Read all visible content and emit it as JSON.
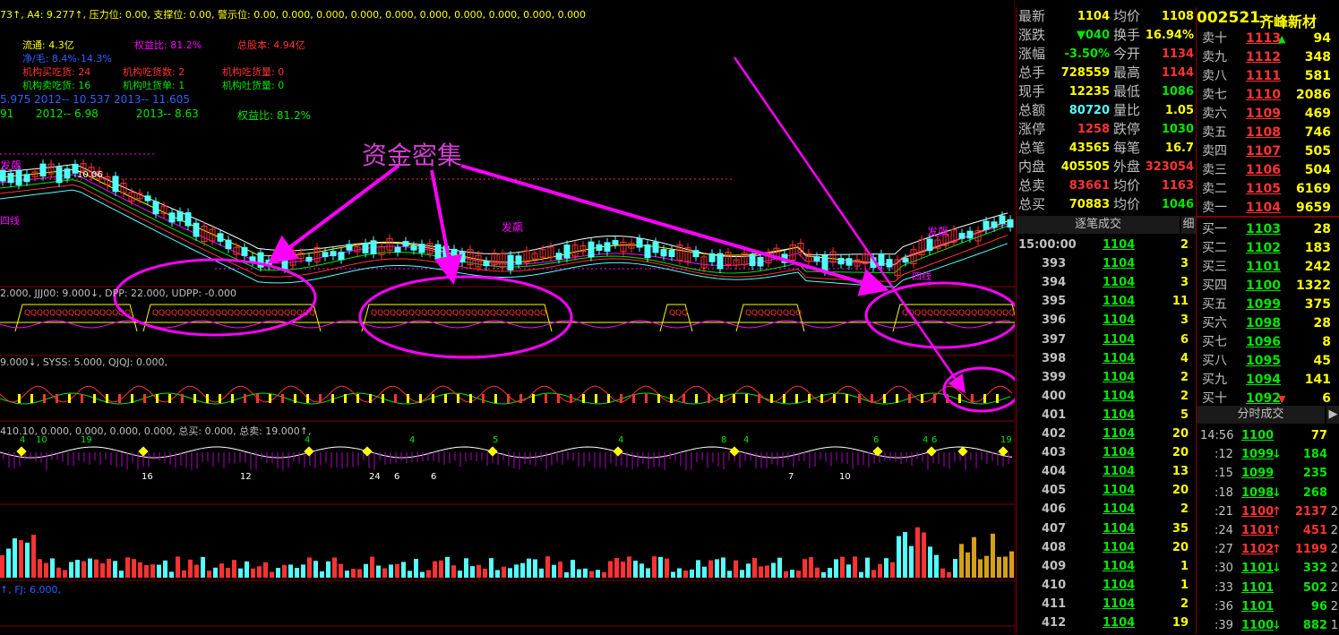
{
  "top_indicator": {
    "line1": "73↑, A4: 9.277↑, 压力位: 0.00, 支撑位: 0.00, 警示位: 0.00, 0.000, 0.000, 0.000, 0.000, 0.000, 0.000, 0.000, 0.000, 0.000",
    "liutong": "流通: 4.3亿",
    "quanyibi": "权益比: 81.2%",
    "zongguben": "总股本: 4.94亿",
    "jinmao": "净/毛: 8.4%-14.3%",
    "jg_buy": "机构买吃货: 24",
    "jg_buy_n": "机构吃货数: 2",
    "jg_buy_amt": "机构吃货量: 0",
    "jg_sell": "机构卖吃货: 16",
    "jg_sell_n": "机构吐货单: 1",
    "jg_sell_amt": "机构吐货量: 0",
    "eps_line": "5.975   2012-- 10.537   2013-- 11.605",
    "pe_line_a": "91",
    "pe_line_b": "2012-- 6.98",
    "pe_line_c": "2013-- 8.63",
    "pe_line_d": "权益比: 81.2%"
  },
  "annotation": {
    "title": "资金密集",
    "fafei_1": "发飙",
    "fafei_2": "发飙",
    "fafei_3": "发飙",
    "sixian": "四线",
    "price_label": "10.06",
    "qixian": "四线"
  },
  "panel2_label": "2.000, JJJ00: 9.000↓, DPP: 22.000, UDPP: -0.000",
  "panel3_label": "9.000↓, SYSS: 5.000, QJQJ: 0.000,",
  "panel4_label": "410.10, 0.000, 0.000, 0.000, 0.000, 总买: 0.000, 总卖: 19.000↑,",
  "panel5_label": "↑, FJ: 6.000,",
  "panel4_numbers": [
    "4",
    "10",
    "19",
    "4",
    "4",
    "5",
    "4",
    "8",
    "4",
    "6",
    "4",
    "6",
    "19"
  ],
  "panel4_bottom": [
    "16",
    "12",
    "24",
    "6",
    "6",
    "7",
    "10"
  ],
  "quote": {
    "code": "002521",
    "name": "齐峰新材",
    "rows": [
      {
        "l1": "最新",
        "v1": "1104",
        "l2": "均价",
        "v2": "1108"
      },
      {
        "l1": "涨跌",
        "v1": "▼040",
        "l2": "换手",
        "v2": "16.94%"
      },
      {
        "l1": "涨幅",
        "v1": "-3.50%",
        "l2": "今开",
        "v2": "1134"
      },
      {
        "l1": "总手",
        "v1": "728559",
        "l2": "最高",
        "v2": "1144"
      },
      {
        "l1": "现手",
        "v1": "12235",
        "l2": "最低",
        "v2": "1086"
      },
      {
        "l1": "总额",
        "v1": "80720",
        "l2": "量比",
        "v2": "1.05"
      },
      {
        "l1": "涨停",
        "v1": "1258",
        "l2": "跌停",
        "v2": "1030"
      },
      {
        "l1": "总笔",
        "v1": "43565",
        "l2": "每笔",
        "v2": "16.7"
      },
      {
        "l1": "内盘",
        "v1": "405505",
        "l2": "外盘",
        "v2": "323054"
      },
      {
        "l1": "总卖",
        "v1": "83661",
        "l2": "均价",
        "v2": "1163"
      },
      {
        "l1": "总买",
        "v1": "70883",
        "l2": "均价",
        "v2": "1046"
      }
    ]
  },
  "ticks_header": "逐笔成交",
  "ticks_detail": "细",
  "ticks": [
    {
      "t": "15:00:00",
      "p": "1104",
      "v": "2"
    },
    {
      "t": "393",
      "p": "1104",
      "v": "3"
    },
    {
      "t": "394",
      "p": "1104",
      "v": "3"
    },
    {
      "t": "395",
      "p": "1104",
      "v": "11"
    },
    {
      "t": "396",
      "p": "1104",
      "v": "3"
    },
    {
      "t": "397",
      "p": "1104",
      "v": "6"
    },
    {
      "t": "398",
      "p": "1104",
      "v": "4"
    },
    {
      "t": "399",
      "p": "1104",
      "v": "2"
    },
    {
      "t": "400",
      "p": "1104",
      "v": "2"
    },
    {
      "t": "401",
      "p": "1104",
      "v": "5"
    },
    {
      "t": "402",
      "p": "1104",
      "v": "20"
    },
    {
      "t": "403",
      "p": "1104",
      "v": "20"
    },
    {
      "t": "404",
      "p": "1104",
      "v": "13"
    },
    {
      "t": "405",
      "p": "1104",
      "v": "20"
    },
    {
      "t": "406",
      "p": "1104",
      "v": "2"
    },
    {
      "t": "407",
      "p": "1104",
      "v": "35"
    },
    {
      "t": "408",
      "p": "1104",
      "v": "20"
    },
    {
      "t": "409",
      "p": "1104",
      "v": "1"
    },
    {
      "t": "410",
      "p": "1104",
      "v": "1"
    },
    {
      "t": "411",
      "p": "1104",
      "v": "2"
    },
    {
      "t": "412",
      "p": "1104",
      "v": "19"
    }
  ],
  "orderbook": {
    "sells": [
      {
        "l": "卖十",
        "p": "1113",
        "v": "94",
        "arrow": "▲"
      },
      {
        "l": "卖九",
        "p": "1112",
        "v": "348",
        "arrow": ""
      },
      {
        "l": "卖八",
        "p": "1111",
        "v": "581",
        "arrow": ""
      },
      {
        "l": "卖七",
        "p": "1110",
        "v": "2086",
        "arrow": ""
      },
      {
        "l": "卖六",
        "p": "1109",
        "v": "469",
        "arrow": ""
      },
      {
        "l": "卖五",
        "p": "1108",
        "v": "746",
        "arrow": ""
      },
      {
        "l": "卖四",
        "p": "1107",
        "v": "505",
        "arrow": ""
      },
      {
        "l": "卖三",
        "p": "1106",
        "v": "504",
        "arrow": ""
      },
      {
        "l": "卖二",
        "p": "1105",
        "v": "6169",
        "arrow": ""
      },
      {
        "l": "卖一",
        "p": "1104",
        "v": "9659",
        "arrow": ""
      }
    ],
    "buys": [
      {
        "l": "买一",
        "p": "1103",
        "v": "28",
        "arrow": ""
      },
      {
        "l": "买二",
        "p": "1102",
        "v": "183",
        "arrow": ""
      },
      {
        "l": "买三",
        "p": "1101",
        "v": "242",
        "arrow": ""
      },
      {
        "l": "买四",
        "p": "1100",
        "v": "1322",
        "arrow": ""
      },
      {
        "l": "买五",
        "p": "1099",
        "v": "375",
        "arrow": ""
      },
      {
        "l": "买六",
        "p": "1098",
        "v": "28",
        "arrow": ""
      },
      {
        "l": "买七",
        "p": "1096",
        "v": "8",
        "arrow": ""
      },
      {
        "l": "买八",
        "p": "1095",
        "v": "45",
        "arrow": ""
      },
      {
        "l": "买九",
        "p": "1094",
        "v": "141",
        "arrow": ""
      },
      {
        "l": "买十",
        "p": "1092",
        "v": "6",
        "arrow": "▼"
      }
    ]
  },
  "rt_header": "分时成交",
  "rt": [
    {
      "t": "14:56",
      "p": "1100",
      "a": "",
      "v": "77"
    },
    {
      "t": ":12",
      "p": "1099",
      "a": "↓",
      "v": "184"
    },
    {
      "t": ":15",
      "p": "1099",
      "a": "",
      "v": "235"
    },
    {
      "t": ":18",
      "p": "1098",
      "a": "↓",
      "v": "268"
    },
    {
      "t": ":21",
      "p": "1100",
      "a": "↑",
      "v": "2137"
    },
    {
      "t": ":24",
      "p": "1101",
      "a": "↑",
      "v": "451"
    },
    {
      "t": ":27",
      "p": "1102",
      "a": "↑",
      "v": "1199"
    },
    {
      "t": ":30",
      "p": "1101",
      "a": "↓",
      "v": "332"
    },
    {
      "t": ":33",
      "p": "1101",
      "a": "",
      "v": "502"
    },
    {
      "t": ":36",
      "p": "1101",
      "a": "",
      "v": "96"
    },
    {
      "t": ":39",
      "p": "1100",
      "a": "↓",
      "v": "882"
    }
  ],
  "rt_side": [
    "2",
    "2",
    "2",
    "2",
    "2",
    "2",
    "1"
  ],
  "colors": {
    "up": "#ff3232",
    "down": "#00e600",
    "yellow": "#ffff00",
    "cyan": "#54ffff",
    "magenta": "#ff00ff",
    "grid": "#800000"
  }
}
